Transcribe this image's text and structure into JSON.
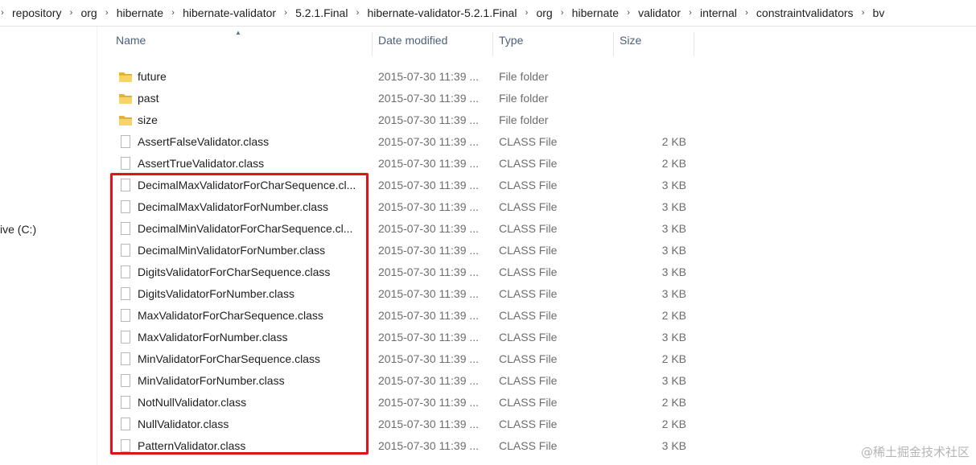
{
  "breadcrumb": [
    "repository",
    "org",
    "hibernate",
    "hibernate-validator",
    "5.2.1.Final",
    "hibernate-validator-5.2.1.Final",
    "org",
    "hibernate",
    "validator",
    "internal",
    "constraintvalidators",
    "bv"
  ],
  "nav": {
    "drive_label": "ive (C:)"
  },
  "columns": {
    "name": "Name",
    "date": "Date modified",
    "type": "Type",
    "size": "Size"
  },
  "icons": {
    "folder": "folder-icon",
    "file": "file-icon",
    "separator": "chevron-right-icon",
    "sort": "sort-up-icon"
  },
  "rows": [
    {
      "name": "future",
      "date": "2015-07-30 11:39 ...",
      "type": "File folder",
      "size": "",
      "kind": "folder"
    },
    {
      "name": "past",
      "date": "2015-07-30 11:39 ...",
      "type": "File folder",
      "size": "",
      "kind": "folder"
    },
    {
      "name": "size",
      "date": "2015-07-30 11:39 ...",
      "type": "File folder",
      "size": "",
      "kind": "folder"
    },
    {
      "name": "AssertFalseValidator.class",
      "date": "2015-07-30 11:39 ...",
      "type": "CLASS File",
      "size": "2 KB",
      "kind": "file"
    },
    {
      "name": "AssertTrueValidator.class",
      "date": "2015-07-30 11:39 ...",
      "type": "CLASS File",
      "size": "2 KB",
      "kind": "file"
    },
    {
      "name": "DecimalMaxValidatorForCharSequence.cl...",
      "date": "2015-07-30 11:39 ...",
      "type": "CLASS File",
      "size": "3 KB",
      "kind": "file"
    },
    {
      "name": "DecimalMaxValidatorForNumber.class",
      "date": "2015-07-30 11:39 ...",
      "type": "CLASS File",
      "size": "3 KB",
      "kind": "file"
    },
    {
      "name": "DecimalMinValidatorForCharSequence.cl...",
      "date": "2015-07-30 11:39 ...",
      "type": "CLASS File",
      "size": "3 KB",
      "kind": "file"
    },
    {
      "name": "DecimalMinValidatorForNumber.class",
      "date": "2015-07-30 11:39 ...",
      "type": "CLASS File",
      "size": "3 KB",
      "kind": "file"
    },
    {
      "name": "DigitsValidatorForCharSequence.class",
      "date": "2015-07-30 11:39 ...",
      "type": "CLASS File",
      "size": "3 KB",
      "kind": "file"
    },
    {
      "name": "DigitsValidatorForNumber.class",
      "date": "2015-07-30 11:39 ...",
      "type": "CLASS File",
      "size": "3 KB",
      "kind": "file"
    },
    {
      "name": "MaxValidatorForCharSequence.class",
      "date": "2015-07-30 11:39 ...",
      "type": "CLASS File",
      "size": "2 KB",
      "kind": "file"
    },
    {
      "name": "MaxValidatorForNumber.class",
      "date": "2015-07-30 11:39 ...",
      "type": "CLASS File",
      "size": "3 KB",
      "kind": "file"
    },
    {
      "name": "MinValidatorForCharSequence.class",
      "date": "2015-07-30 11:39 ...",
      "type": "CLASS File",
      "size": "2 KB",
      "kind": "file"
    },
    {
      "name": "MinValidatorForNumber.class",
      "date": "2015-07-30 11:39 ...",
      "type": "CLASS File",
      "size": "3 KB",
      "kind": "file"
    },
    {
      "name": "NotNullValidator.class",
      "date": "2015-07-30 11:39 ...",
      "type": "CLASS File",
      "size": "2 KB",
      "kind": "file"
    },
    {
      "name": "NullValidator.class",
      "date": "2015-07-30 11:39 ...",
      "type": "CLASS File",
      "size": "2 KB",
      "kind": "file"
    },
    {
      "name": "PatternValidator.class",
      "date": "2015-07-30 11:39 ...",
      "type": "CLASS File",
      "size": "3 KB",
      "kind": "file"
    }
  ],
  "annotation": {
    "highlight_color": "#e0131b"
  },
  "watermark": "@稀土掘金技术社区"
}
